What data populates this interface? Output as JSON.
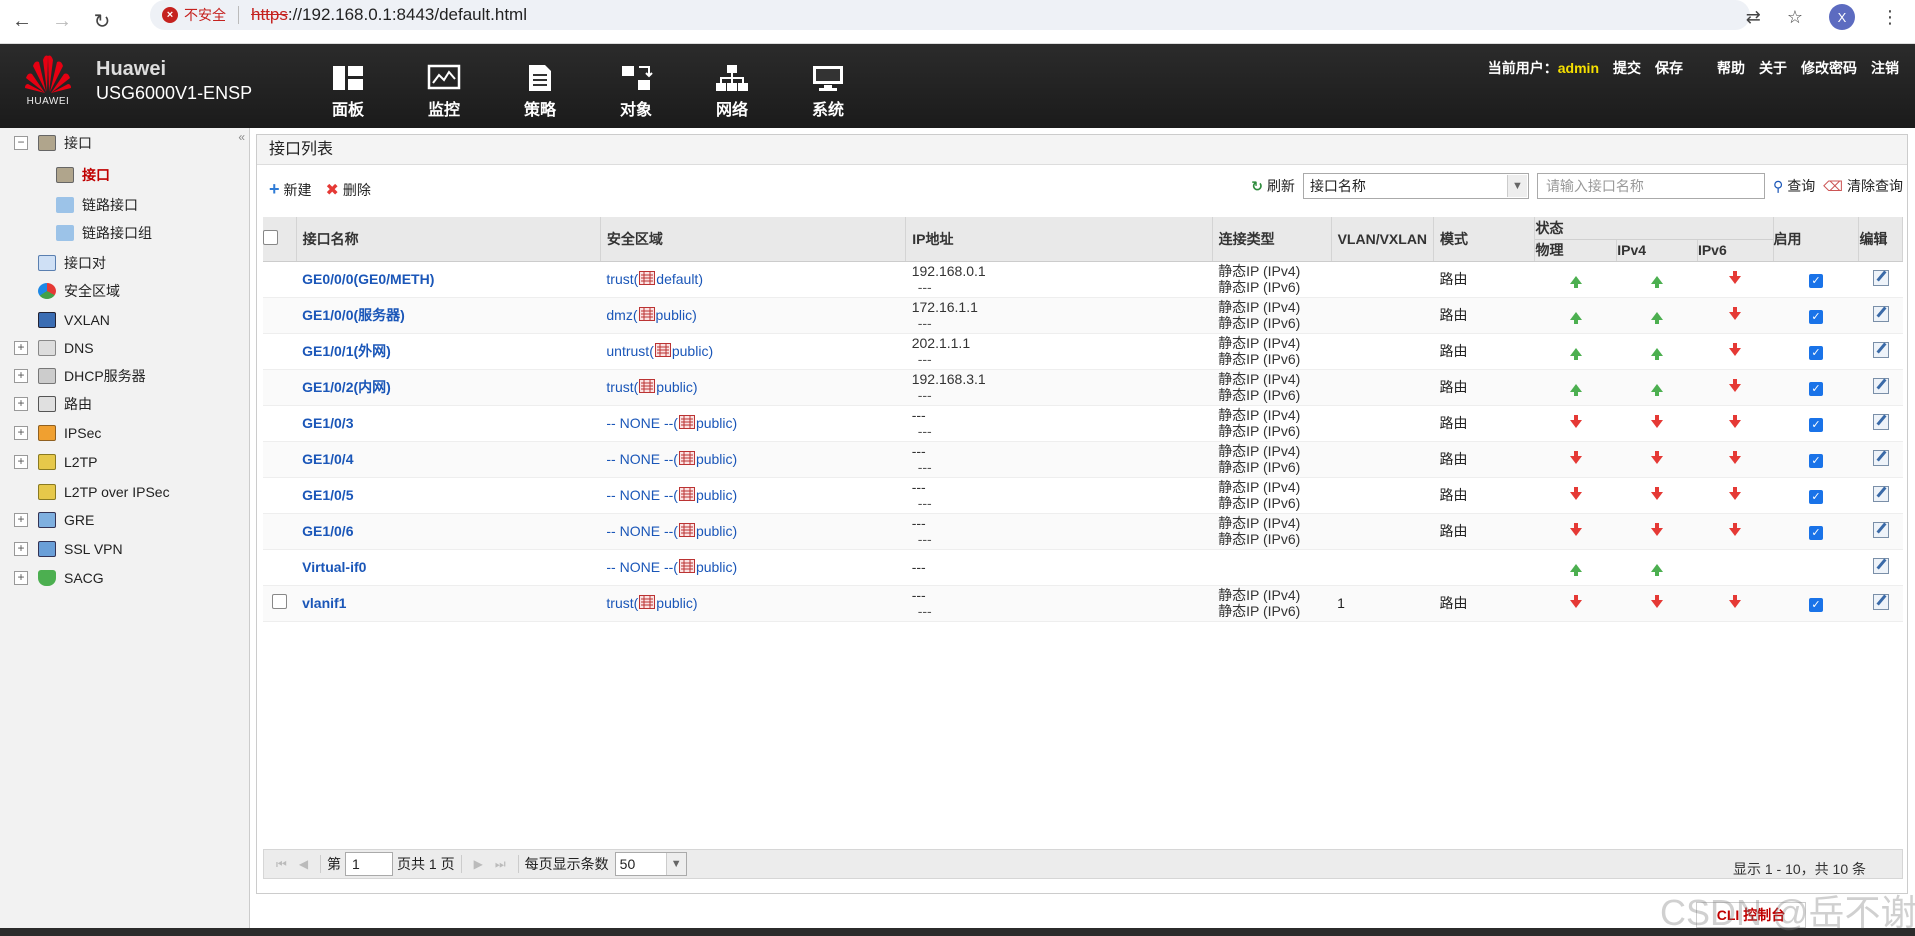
{
  "browser": {
    "security_label": "不安全",
    "url_scheme": "https",
    "url_rest": "://192.168.0.1:8443/default.html",
    "profile_initial": "X"
  },
  "header": {
    "logo_text": "HUAWEI",
    "brand_line1": "Huawei",
    "brand_line2": "USG6000V1-ENSP",
    "nav": [
      {
        "label": "面板",
        "icon": "dashboard-icon"
      },
      {
        "label": "监控",
        "icon": "monitor-icon"
      },
      {
        "label": "策略",
        "icon": "policy-icon"
      },
      {
        "label": "对象",
        "icon": "object-icon"
      },
      {
        "label": "网络",
        "icon": "network-icon"
      },
      {
        "label": "系统",
        "icon": "system-icon"
      }
    ],
    "current_user_label": "当前用户：",
    "current_user": "admin",
    "links": [
      "提交",
      "保存",
      "帮助",
      "关于",
      "修改密码",
      "注销"
    ]
  },
  "sidebar": {
    "items": [
      {
        "label": "接口",
        "expander": "−"
      },
      {
        "label": "接口",
        "active": true
      },
      {
        "label": "链路接口"
      },
      {
        "label": "链路接口组"
      },
      {
        "label": "接口对"
      },
      {
        "label": "安全区域"
      },
      {
        "label": "VXLAN"
      },
      {
        "label": "DNS",
        "expander": "+"
      },
      {
        "label": "DHCP服务器",
        "expander": "+"
      },
      {
        "label": "路由",
        "expander": "+"
      },
      {
        "label": "IPSec",
        "expander": "+"
      },
      {
        "label": "L2TP",
        "expander": "+"
      },
      {
        "label": "L2TP over IPSec"
      },
      {
        "label": "GRE",
        "expander": "+"
      },
      {
        "label": "SSL VPN",
        "expander": "+"
      },
      {
        "label": "SACG",
        "expander": "+"
      }
    ]
  },
  "panel": {
    "title": "接口列表",
    "new_label": "新建",
    "delete_label": "删除",
    "refresh_label": "刷新",
    "filter_select": "接口名称",
    "search_placeholder": "请输入接口名称",
    "query_label": "查询",
    "clear_label": "清除查询"
  },
  "table": {
    "headers": {
      "name": "接口名称",
      "zone": "安全区域",
      "ip": "IP地址",
      "conn": "连接类型",
      "vlan": "VLAN/VXLAN",
      "mode": "模式",
      "status": "状态",
      "phys": "物理",
      "ipv4": "IPv4",
      "ipv6": "IPv6",
      "enable": "启用",
      "edit": "编辑"
    },
    "rows": [
      {
        "name": "GE0/0/0(GE0/METH)",
        "zone": "trust(",
        "vsys": "default)",
        "ip1": "192.168.0.1",
        "ip2": "---",
        "conn1": "静态IP (IPv4)",
        "conn2": "静态IP (IPv6)",
        "vlan": "",
        "mode": "路由",
        "phys": "up",
        "ipv4": "up",
        "ipv6": "down",
        "enabled": true
      },
      {
        "name": "GE1/0/0(服务器)",
        "zone": "dmz(",
        "vsys": "public)",
        "ip1": "172.16.1.1",
        "ip2": "---",
        "conn1": "静态IP (IPv4)",
        "conn2": "静态IP (IPv6)",
        "vlan": "",
        "mode": "路由",
        "phys": "up",
        "ipv4": "up",
        "ipv6": "down",
        "enabled": true
      },
      {
        "name": "GE1/0/1(外网)",
        "zone": "untrust(",
        "vsys": "public)",
        "ip1": "202.1.1.1",
        "ip2": "---",
        "conn1": "静态IP (IPv4)",
        "conn2": "静态IP (IPv6)",
        "vlan": "",
        "mode": "路由",
        "phys": "up",
        "ipv4": "up",
        "ipv6": "down",
        "enabled": true
      },
      {
        "name": "GE1/0/2(内网)",
        "zone": "trust(",
        "vsys": "public)",
        "ip1": "192.168.3.1",
        "ip2": "---",
        "conn1": "静态IP (IPv4)",
        "conn2": "静态IP (IPv6)",
        "vlan": "",
        "mode": "路由",
        "phys": "up",
        "ipv4": "up",
        "ipv6": "down",
        "enabled": true
      },
      {
        "name": "GE1/0/3",
        "zone": "-- NONE --(",
        "vsys": "public)",
        "ip1": "---",
        "ip2": "---",
        "conn1": "静态IP (IPv4)",
        "conn2": "静态IP (IPv6)",
        "vlan": "",
        "mode": "路由",
        "phys": "down",
        "ipv4": "down",
        "ipv6": "down",
        "enabled": true
      },
      {
        "name": "GE1/0/4",
        "zone": "-- NONE --(",
        "vsys": "public)",
        "ip1": "---",
        "ip2": "---",
        "conn1": "静态IP (IPv4)",
        "conn2": "静态IP (IPv6)",
        "vlan": "",
        "mode": "路由",
        "phys": "down",
        "ipv4": "down",
        "ipv6": "down",
        "enabled": true
      },
      {
        "name": "GE1/0/5",
        "zone": "-- NONE --(",
        "vsys": "public)",
        "ip1": "---",
        "ip2": "---",
        "conn1": "静态IP (IPv4)",
        "conn2": "静态IP (IPv6)",
        "vlan": "",
        "mode": "路由",
        "phys": "down",
        "ipv4": "down",
        "ipv6": "down",
        "enabled": true
      },
      {
        "name": "GE1/0/6",
        "zone": "-- NONE --(",
        "vsys": "public)",
        "ip1": "---",
        "ip2": "---",
        "conn1": "静态IP (IPv4)",
        "conn2": "静态IP (IPv6)",
        "vlan": "",
        "mode": "路由",
        "phys": "down",
        "ipv4": "down",
        "ipv6": "down",
        "enabled": true
      },
      {
        "name": "Virtual-if0",
        "zone": "-- NONE --(",
        "vsys": "public)",
        "ip1": "---",
        "ip2": "",
        "conn1": "",
        "conn2": "",
        "vlan": "",
        "mode": "",
        "phys": "up",
        "ipv4": "up",
        "ipv6": "",
        "enabled": null
      },
      {
        "name": "vlanif1",
        "zone": "trust(",
        "vsys": "public)",
        "ip1": "---",
        "ip2": "---",
        "conn1": "静态IP (IPv4)",
        "conn2": "静态IP (IPv6)",
        "vlan": "1",
        "mode": "路由",
        "phys": "down",
        "ipv4": "down",
        "ipv6": "down",
        "enabled": true,
        "selectable": true
      }
    ]
  },
  "pager": {
    "page_prefix": "第",
    "page_value": "1",
    "page_suffix": "页共 1 页",
    "per_page_label": "每页显示条数",
    "per_page_value": "50",
    "summary": "显示 1 - 10，共 10 条"
  },
  "footer": {
    "cli_label": "CLI 控制台",
    "watermark": "CSDN @岳不谢"
  },
  "colors": {
    "header_bg": "#222222",
    "link_blue": "#1a56b8",
    "status_up": "#4caf50",
    "status_down": "#e53935",
    "active_red": "#c00000"
  }
}
